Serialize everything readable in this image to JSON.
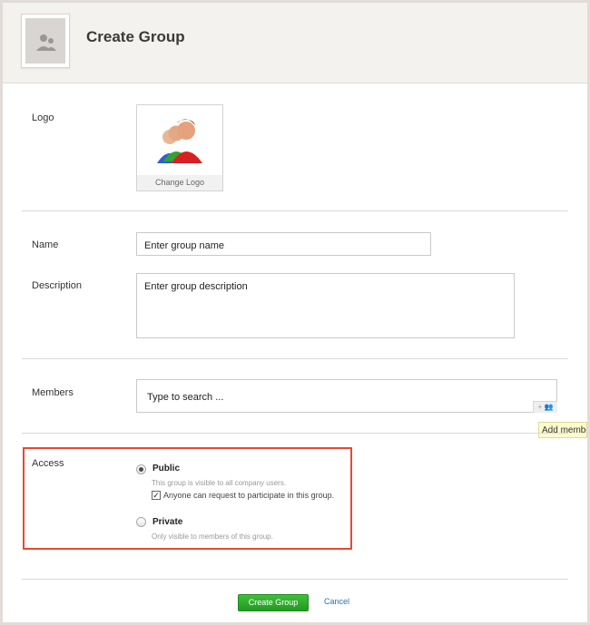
{
  "header": {
    "title": "Create Group"
  },
  "logo": {
    "label": "Logo",
    "change_label": "Change Logo"
  },
  "name": {
    "label": "Name",
    "placeholder": "Enter group name"
  },
  "description": {
    "label": "Description",
    "placeholder": "Enter group description"
  },
  "members": {
    "label": "Members",
    "placeholder": "Type to search ...",
    "add_button_glyph": "+ 👥",
    "tooltip": "Add member"
  },
  "access": {
    "label": "Access",
    "options": [
      {
        "label": "Public",
        "hint": "This group is visible to all company users.",
        "selected": true,
        "sub_option": {
          "label": "Anyone can request to participate in this group.",
          "checked": true
        }
      },
      {
        "label": "Private",
        "hint": "Only visible to members of this group.",
        "selected": false
      }
    ]
  },
  "actions": {
    "create_label": "Create Group",
    "cancel_label": "Cancel"
  },
  "colors": {
    "highlight_border": "#e8492f",
    "primary_button": "#2aa526",
    "link": "#2d6fb3"
  },
  "icons": {
    "header_avatar": "group-placeholder-icon",
    "logo_image": "group-people-icon",
    "add_member": "add-people-icon"
  }
}
